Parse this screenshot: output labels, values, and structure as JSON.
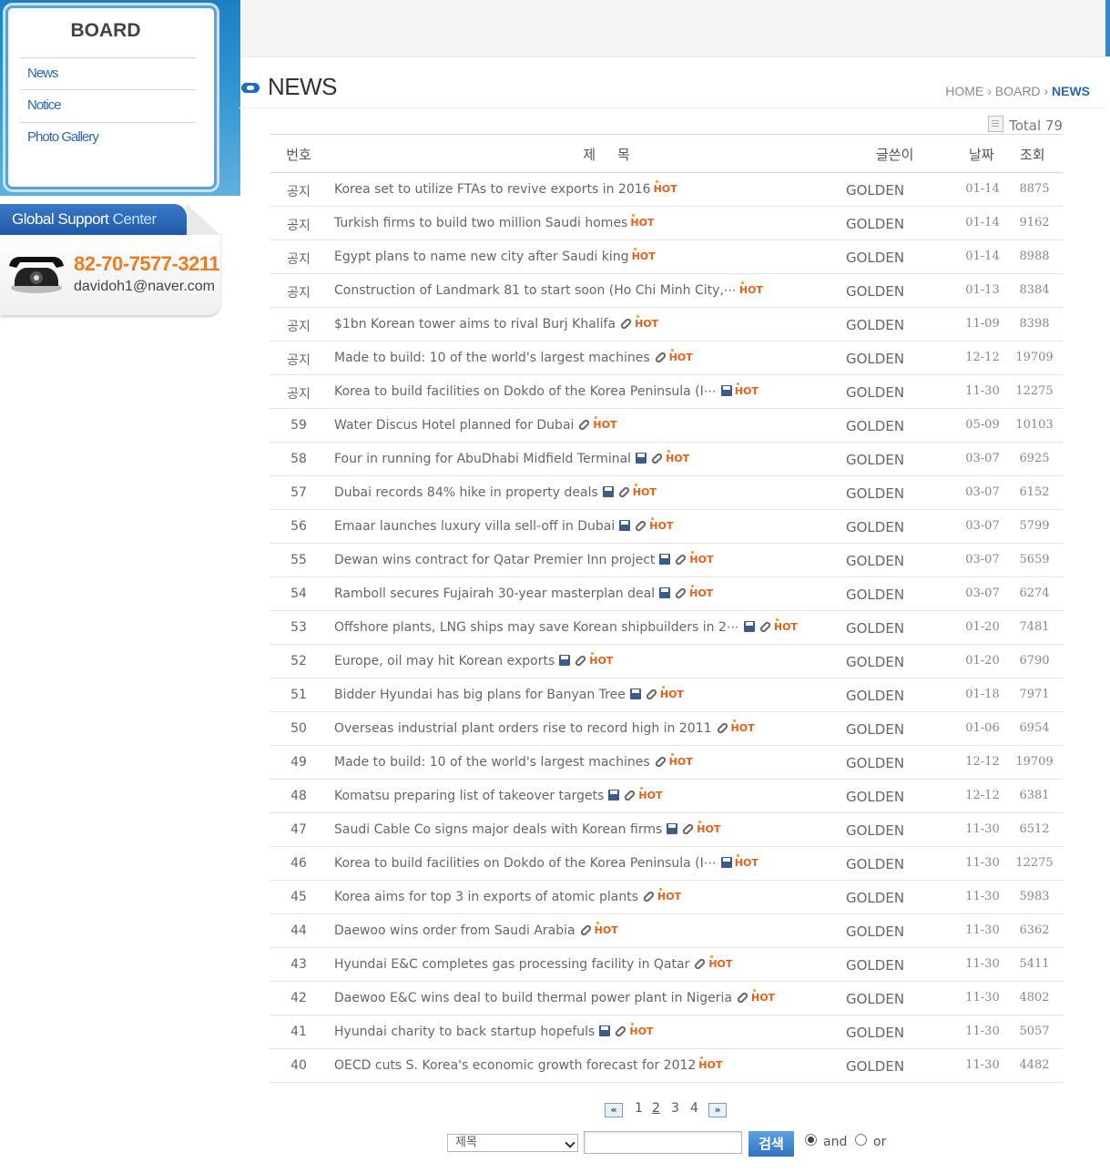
{
  "sidebar": {
    "board_title": "BOARD",
    "links": [
      "News",
      "Notice",
      "Photo Gallery"
    ],
    "support_title_a": "Global Support ",
    "support_title_b": "Center",
    "phone": "82-70-7577-3211",
    "email": "davidoh1@naver.com"
  },
  "header": {
    "title": "NEWS",
    "breadcrumb": {
      "home": "HOME",
      "sep": "›",
      "board": "BOARD",
      "current": "NEWS"
    },
    "total_label": "Total",
    "total_count": "79"
  },
  "table": {
    "columns": {
      "num": "번호",
      "title": "제     목",
      "writer": "글쓴이",
      "date": "날짜",
      "views": "조회"
    },
    "hot_label": "HOT",
    "rows": [
      {
        "num": "공지",
        "title": "Korea set to utilize FTAs to revive exports in 2016",
        "disk": false,
        "clip": false,
        "writer": "GOLDEN",
        "date": "01-14",
        "views": "8875"
      },
      {
        "num": "공지",
        "title": "Turkish firms to build two million Saudi homes",
        "disk": false,
        "clip": false,
        "writer": "GOLDEN",
        "date": "01-14",
        "views": "9162"
      },
      {
        "num": "공지",
        "title": "Egypt plans to name new city after Saudi king",
        "disk": false,
        "clip": false,
        "writer": "GOLDEN",
        "date": "01-14",
        "views": "8988"
      },
      {
        "num": "공지",
        "title": "Construction of Landmark 81 to start soon (Ho Chi Minh City,⋯",
        "disk": false,
        "clip": false,
        "writer": "GOLDEN",
        "date": "01-13",
        "views": "8384"
      },
      {
        "num": "공지",
        "title": "$1bn Korean tower aims to rival Burj Khalifa",
        "disk": false,
        "clip": true,
        "writer": "GOLDEN",
        "date": "11-09",
        "views": "8398"
      },
      {
        "num": "공지",
        "title": "Made to build: 10 of the world's largest machines",
        "disk": false,
        "clip": true,
        "writer": "GOLDEN",
        "date": "12-12",
        "views": "19709"
      },
      {
        "num": "공지",
        "title": "Korea to build facilities on Dokdo of the Korea Peninsula (I⋯",
        "disk": true,
        "clip": false,
        "writer": "GOLDEN",
        "date": "11-30",
        "views": "12275"
      },
      {
        "num": "59",
        "title": "Water Discus Hotel planned for Dubai",
        "disk": false,
        "clip": true,
        "writer": "GOLDEN",
        "date": "05-09",
        "views": "10103"
      },
      {
        "num": "58",
        "title": "Four in running for AbuDhabi Midfield Terminal",
        "disk": true,
        "clip": true,
        "writer": "GOLDEN",
        "date": "03-07",
        "views": "6925"
      },
      {
        "num": "57",
        "title": "Dubai records 84% hike in property deals",
        "disk": true,
        "clip": true,
        "writer": "GOLDEN",
        "date": "03-07",
        "views": "6152"
      },
      {
        "num": "56",
        "title": "Emaar launches luxury villa sell-off in Dubai",
        "disk": true,
        "clip": true,
        "writer": "GOLDEN",
        "date": "03-07",
        "views": "5799"
      },
      {
        "num": "55",
        "title": "Dewan wins contract for Qatar Premier Inn project",
        "disk": true,
        "clip": true,
        "writer": "GOLDEN",
        "date": "03-07",
        "views": "5659"
      },
      {
        "num": "54",
        "title": "Ramboll secures Fujairah 30-year masterplan deal",
        "disk": true,
        "clip": true,
        "writer": "GOLDEN",
        "date": "03-07",
        "views": "6274"
      },
      {
        "num": "53",
        "title": "Offshore plants, LNG ships may save Korean shipbuilders in 2⋯",
        "disk": true,
        "clip": true,
        "writer": "GOLDEN",
        "date": "01-20",
        "views": "7481"
      },
      {
        "num": "52",
        "title": "Europe, oil may hit Korean exports",
        "disk": true,
        "clip": true,
        "writer": "GOLDEN",
        "date": "01-20",
        "views": "6790"
      },
      {
        "num": "51",
        "title": "Bidder Hyundai has big plans for Banyan Tree",
        "disk": true,
        "clip": true,
        "writer": "GOLDEN",
        "date": "01-18",
        "views": "7971"
      },
      {
        "num": "50",
        "title": "Overseas industrial plant orders rise to record high in 2011",
        "disk": false,
        "clip": true,
        "writer": "GOLDEN",
        "date": "01-06",
        "views": "6954"
      },
      {
        "num": "49",
        "title": "Made to build: 10 of the world's largest machines",
        "disk": false,
        "clip": true,
        "writer": "GOLDEN",
        "date": "12-12",
        "views": "19709"
      },
      {
        "num": "48",
        "title": "Komatsu preparing list of takeover targets",
        "disk": true,
        "clip": true,
        "writer": "GOLDEN",
        "date": "12-12",
        "views": "6381"
      },
      {
        "num": "47",
        "title": "Saudi Cable Co signs major deals with Korean firms",
        "disk": true,
        "clip": true,
        "writer": "GOLDEN",
        "date": "11-30",
        "views": "6512"
      },
      {
        "num": "46",
        "title": "Korea to build facilities on Dokdo of the Korea Peninsula (I⋯",
        "disk": true,
        "clip": false,
        "writer": "GOLDEN",
        "date": "11-30",
        "views": "12275"
      },
      {
        "num": "45",
        "title": "Korea aims for top 3 in exports of atomic plants",
        "disk": false,
        "clip": true,
        "writer": "GOLDEN",
        "date": "11-30",
        "views": "5983"
      },
      {
        "num": "44",
        "title": "Daewoo wins order from Saudi Arabia",
        "disk": false,
        "clip": true,
        "writer": "GOLDEN",
        "date": "11-30",
        "views": "6362"
      },
      {
        "num": "43",
        "title": "Hyundai E&C completes gas processing facility in Qatar",
        "disk": false,
        "clip": true,
        "writer": "GOLDEN",
        "date": "11-30",
        "views": "5411"
      },
      {
        "num": "42",
        "title": "Daewoo E&C wins deal to build thermal power plant in Nigeria",
        "disk": false,
        "clip": true,
        "writer": "GOLDEN",
        "date": "11-30",
        "views": "4802"
      },
      {
        "num": "41",
        "title": "Hyundai charity to back startup hopefuls",
        "disk": true,
        "clip": true,
        "writer": "GOLDEN",
        "date": "11-30",
        "views": "5057"
      },
      {
        "num": "40",
        "title": "OECD cuts S. Korea's economic growth forecast for 2012",
        "disk": false,
        "clip": false,
        "writer": "GOLDEN",
        "date": "11-30",
        "views": "4482"
      }
    ]
  },
  "pagination": {
    "prev": "«",
    "next": "»",
    "pages": [
      "1",
      "2",
      "3",
      "4"
    ],
    "current": "2"
  },
  "search": {
    "field_value": "제목",
    "button": "검색",
    "radio_and": "and",
    "radio_or": "or",
    "selected": "and"
  }
}
